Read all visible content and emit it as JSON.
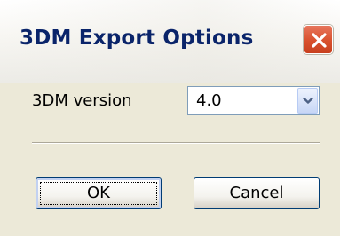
{
  "window": {
    "title": "3DM Export Options",
    "close_icon": "close-icon"
  },
  "form": {
    "version_label": "3DM version",
    "version_value": "4.0",
    "dropdown_icon": "chevron-down-icon"
  },
  "buttons": {
    "ok_label": "OK",
    "cancel_label": "Cancel"
  },
  "colors": {
    "title_text": "#0a246a",
    "close_button": "#d9512d",
    "dialog_background": "#ece9d8",
    "button_border": "#003c74"
  }
}
